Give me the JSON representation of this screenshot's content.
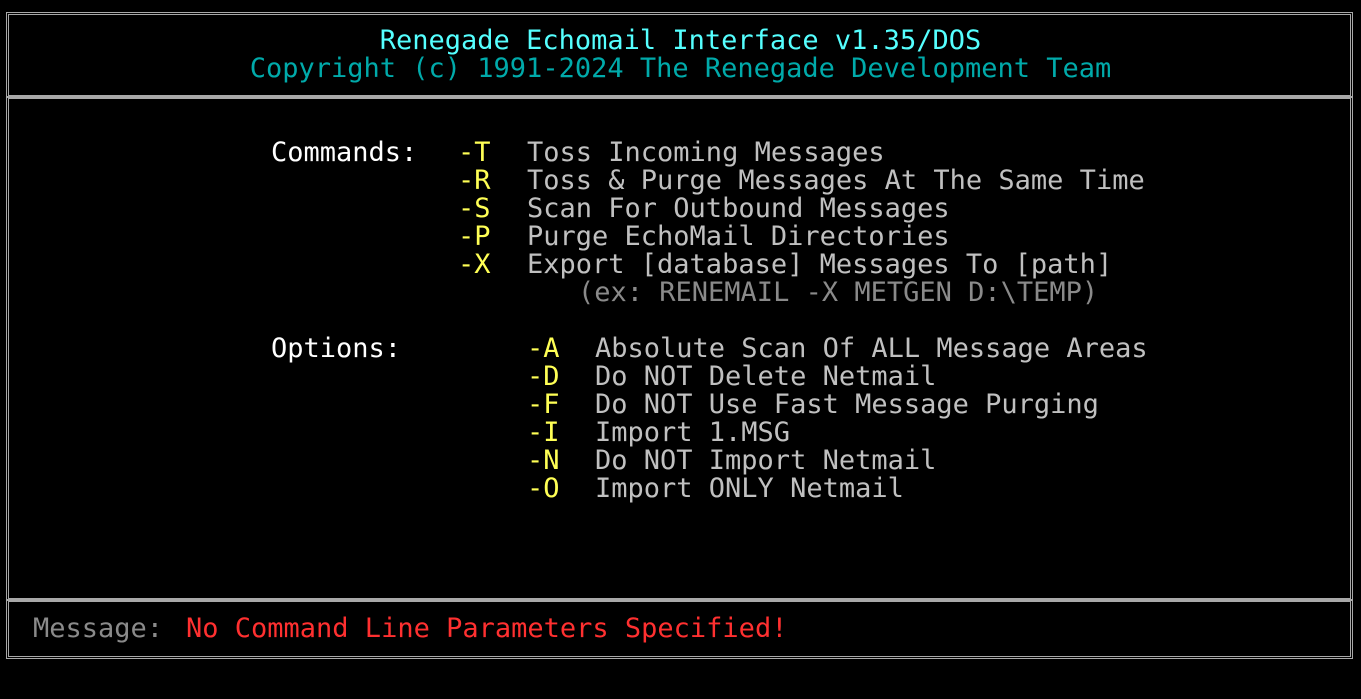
{
  "header": {
    "title": "Renegade Echomail Interface v1.35/DOS",
    "copyright": "Copyright (c) 1991-2024 The Renegade Development Team"
  },
  "commands": {
    "label": "Commands:",
    "items": [
      {
        "flag": "-T",
        "desc": "Toss Incoming Messages"
      },
      {
        "flag": "-R",
        "desc": "Toss & Purge Messages At The Same Time"
      },
      {
        "flag": "-S",
        "desc": "Scan For Outbound Messages"
      },
      {
        "flag": "-P",
        "desc": "Purge EchoMail Directories"
      },
      {
        "flag": "-X",
        "desc": "Export [database] Messages To [path]"
      }
    ],
    "example": "(ex: RENEMAIL -X METGEN D:\\TEMP)"
  },
  "options": {
    "label": "Options:",
    "items": [
      {
        "flag": "-A",
        "desc": "Absolute Scan Of ALL Message Areas"
      },
      {
        "flag": "-D",
        "desc": "Do NOT Delete Netmail"
      },
      {
        "flag": "-F",
        "desc": "Do NOT Use Fast Message Purging"
      },
      {
        "flag": "-I",
        "desc": "Import 1.MSG"
      },
      {
        "flag": "-N",
        "desc": "Do NOT Import Netmail"
      },
      {
        "flag": "-O",
        "desc": "Import ONLY Netmail"
      }
    ]
  },
  "status": {
    "label": "Message:",
    "text": "No Command Line Parameters Specified!"
  },
  "colors": {
    "background": "#000000",
    "frame": "#a8a8a8",
    "title": "#55ffff",
    "copyright": "#00aaaa",
    "label": "#ffffff",
    "flag": "#ffff55",
    "description": "#c0c0c0",
    "example": "#8a8a8a",
    "error": "#ff3030"
  }
}
